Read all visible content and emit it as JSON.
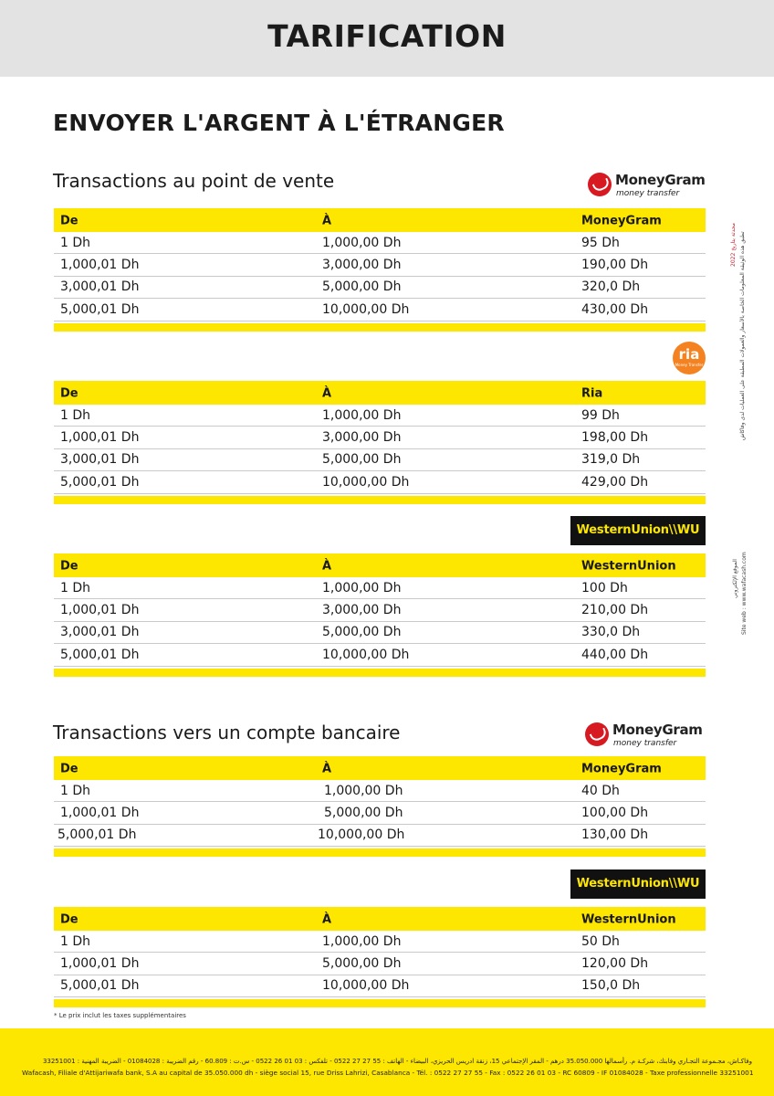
{
  "header": {
    "title": "TARIFICATION"
  },
  "main_heading": "ENVOYER L'ARGENT À L'ÉTRANGER",
  "section_pos": {
    "title": "Transactions au point de vente",
    "moneygram": {
      "logo": {
        "brand": "MoneyGram",
        "sub": "money transfer"
      },
      "columns": [
        "De",
        "À",
        "MoneyGram"
      ],
      "rows": [
        [
          "1 Dh",
          "1,000,00 Dh",
          "95 Dh"
        ],
        [
          "1,000,01 Dh",
          "3,000,00 Dh",
          "190,00 Dh"
        ],
        [
          "3,000,01 Dh",
          "5,000,00 Dh",
          "320,0 Dh"
        ],
        [
          "5,000,01 Dh",
          "10,000,00 Dh",
          "430,00 Dh"
        ]
      ]
    },
    "ria": {
      "logo": {
        "brand": "ria",
        "sub": "Money Transfer"
      },
      "columns": [
        "De",
        "À",
        "Ria"
      ],
      "rows": [
        [
          "1 Dh",
          "1,000,00 Dh",
          "99 Dh"
        ],
        [
          "1,000,01 Dh",
          "3,000,00 Dh",
          "198,00 Dh"
        ],
        [
          "3,000,01 Dh",
          "5,000,00 Dh",
          "319,0 Dh"
        ],
        [
          "5,000,01 Dh",
          "10,000,00 Dh",
          "429,00 Dh"
        ]
      ]
    },
    "westernunion": {
      "logo": {
        "brand": "WesternUnion\\\\WU"
      },
      "columns": [
        "De",
        "À",
        "WesternUnion"
      ],
      "rows": [
        [
          "1 Dh",
          "1,000,00 Dh",
          "100 Dh"
        ],
        [
          "1,000,01 Dh",
          "3,000,00 Dh",
          "210,00 Dh"
        ],
        [
          "3,000,01 Dh",
          "5,000,00 Dh",
          "330,0 Dh"
        ],
        [
          "5,000,01 Dh",
          "10,000,00 Dh",
          "440,00 Dh"
        ]
      ]
    }
  },
  "section_bank": {
    "title": "Transactions vers un compte bancaire",
    "moneygram": {
      "logo": {
        "brand": "MoneyGram",
        "sub": "money transfer"
      },
      "columns": [
        "De",
        "À",
        "MoneyGram"
      ],
      "rows": [
        [
          "1 Dh",
          "1,000,00 Dh",
          "40 Dh"
        ],
        [
          "1,000,01 Dh",
          "5,000,00 Dh",
          "100,00 Dh"
        ],
        [
          "5,000,01 Dh",
          "10,000,00 Dh",
          "130,00 Dh"
        ]
      ]
    },
    "westernunion": {
      "logo": {
        "brand": "WesternUnion\\\\WU"
      },
      "columns": [
        "De",
        "À",
        "WesternUnion"
      ],
      "rows": [
        [
          "1 Dh",
          "1,000,00 Dh",
          "50 Dh"
        ],
        [
          "1,000,01 Dh",
          "5,000,00 Dh",
          "120,00 Dh"
        ],
        [
          "5,000,01 Dh",
          "10,000,00 Dh",
          "150,0 Dh"
        ]
      ]
    }
  },
  "side_notes": {
    "upper_red": "محدثة بتاريخ 2022",
    "upper": "تطبق هذه الوثيقة المعلومات الخاصة بالأسعار والعمولات المطبقة على العمليات لدى وفاكاش",
    "lower_site": "Site web : www.wafacash.com",
    "lower": "الموقع الإلكتروني"
  },
  "footnote": "* Le prix inclut les taxes supplémentaires",
  "footer": {
    "arabic": "وفاكـاش، مجـموعة التجـاري وفابنك، شركـة م. رأسمالها 35.050.000 درهم - المقر الإجتماعي 15، زنقة ادريس الحريزي، البيضاء - الهاتف : 55 27 27 0522 - تلفكس : 03 01 26 0522 - س.ت : 60.809 - رقم الضريبة : 01084028 - الضريبة المهنية : 33251001",
    "french": "Wafacash, Filiale d'Attijariwafa bank, S.A au capital de 35.050.000 dh - siège social 15, rue Driss Lahrizi, Casablanca - Tél. : 0522 27 27 55 - Fax : 0522 26 01 03 - RC 60809 - IF 01084028 - Taxe professionnelle 33251001"
  }
}
